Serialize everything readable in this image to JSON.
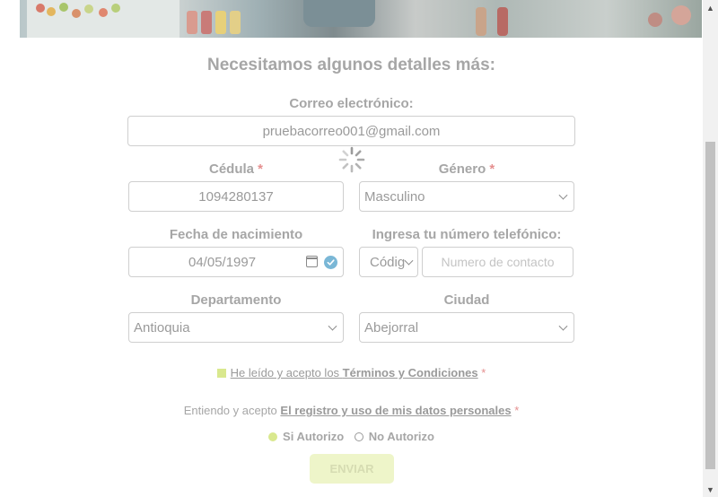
{
  "form": {
    "title": "Necesitamos algunos detalles más:",
    "email_label": "Correo electrónico:",
    "email_value": "pruebacorreo001@gmail.com",
    "id_label": "Cédula",
    "id_value": "1094280137",
    "gender_label": "Género",
    "gender_value": "Masculino",
    "birth_label": "Fecha de nacimiento",
    "birth_value": "04/05/1997",
    "phone_label": "Ingresa tu número telefónico:",
    "phone_code_value": "Códig",
    "phone_placeholder": "Numero de contacto",
    "department_label": "Departamento",
    "department_value": "Antioquia",
    "city_label": "Ciudad",
    "city_value": "Abejorral",
    "required_mark": "*"
  },
  "terms": {
    "prefix": "He leído y acepto los",
    "link": "Términos y Condiciones"
  },
  "consent": {
    "prefix": "Entiendo y acepto",
    "link": "El registro y uso de mis datos personales"
  },
  "authorization": {
    "yes_label": "Si Autorizo",
    "no_label": "No Autorizo",
    "selected": "Si Autorizo"
  },
  "submit_label": "ENVIAR",
  "colors": {
    "accent": "#d9e88e",
    "required": "#e58f8f",
    "valid": "#7ab7d6"
  }
}
